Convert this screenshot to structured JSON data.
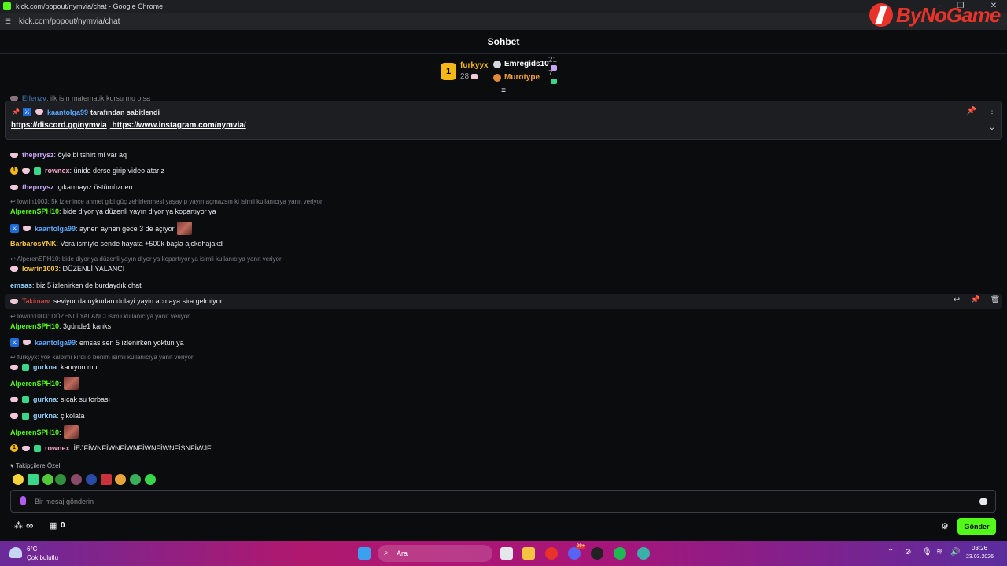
{
  "browser": {
    "title": "kick.com/popout/nymvia/chat - Google Chrome",
    "url": "kick.com/popout/nymvia/chat"
  },
  "watermark": "ByNoGame",
  "chat_header": {
    "title": "Sohbet"
  },
  "leaderboard": {
    "first": {
      "rank": "1",
      "name": "furkyyx",
      "count": "28"
    },
    "second": {
      "name": "Emregids10",
      "count": "21"
    },
    "third": {
      "name": "Murotype",
      "count": "7"
    }
  },
  "pinned": {
    "by_user": "kaantolga99",
    "by_text": "tarafından sabitlendi",
    "link1": "https://discord.gg/nymvia",
    "link2": "https://www.instagram.com/nymvia/"
  },
  "partial_top": {
    "user": "Ellenzv",
    "text": ": ilk işin matematik korsu mu olsa"
  },
  "messages": [
    {
      "user": "theprrysz",
      "text": ": öyle bi tshirt mi var aq",
      "color": "#c7a6f5"
    },
    {
      "user": "rownex",
      "text": ": ünide derse girip video atarız",
      "color": "#f5a3c7"
    },
    {
      "user": "theprrysz",
      "text": ": çıkarmayız üstümüzden",
      "color": "#c7a6f5"
    },
    {
      "reply": "lowrin1003: 5k izlenince ahmet gibi güç zehirlenmesi yaşayıp yayın açmazsın ki isimli kullanıcıya yanıt veriyor"
    },
    {
      "user": "AlperenSPH10",
      "text": ": bide diyor ya düzenli yayın diyor ya kopartıyor ya",
      "color": "#53fc18"
    },
    {
      "user": "kaantolga99",
      "text": ": aynen aynen gece 3 de açıyor",
      "color": "#5aa8ff"
    },
    {
      "user": "BarbarosYNK",
      "text": ": Vera ismiyle sende hayata +500k başla ajckdhajakd",
      "color": "#f5c542"
    },
    {
      "reply": "AlperenSPH10: bide diyor ya düzenli yayın diyor ya kopartıyor ya isimli kullanıcıya yanıt veriyor"
    },
    {
      "user": "lowrin1003",
      "text": ": DÜZENLİ YALANCI",
      "color": "#f5c542"
    },
    {
      "user": "emsas",
      "text": ": biz 5 izlenirken de burdaydık chat",
      "color": "#8fd3ff"
    },
    {
      "user": "Takimaw",
      "text": ": seviyor da uykudan dolayi yayin acmaya sira gelmiyor",
      "color": "#ff4d4d"
    },
    {
      "reply": "lowrin1003: DÜZENLİ YALANCI isimli kullanıcıya yanıt veriyor"
    },
    {
      "user": "AlperenSPH10",
      "text": ": 3günde1 kanks",
      "color": "#53fc18"
    },
    {
      "user": "kaantolga99",
      "text": ": emsas sen 5 izlenirken yoktun ya",
      "color": "#5aa8ff"
    },
    {
      "reply": "furkyyx: yok kalbimi kırdı o benim isimli kullanıcıya yanıt veriyor"
    },
    {
      "user": "gurkna",
      "text": ": kanıyon mu",
      "color": "#8fd3ff"
    },
    {
      "user": "AlperenSPH10",
      "text": ":",
      "color": "#53fc18"
    },
    {
      "user": "gurkna",
      "text": ": sıcak su torbası",
      "color": "#8fd3ff"
    },
    {
      "user": "gurkna",
      "text": ": çikolata",
      "color": "#8fd3ff"
    },
    {
      "user": "AlperenSPH10",
      "text": ":",
      "color": "#53fc18"
    },
    {
      "user": "rownex",
      "text": ": İEJFİWNFİWNFİWNFİWNFİWNFİSNFİWJF",
      "color": "#f5a3c7"
    }
  ],
  "emote_bar": {
    "label": "Takipçilere Özel"
  },
  "input": {
    "placeholder": "Bir mesaj gönderin"
  },
  "bottom": {
    "infinity": "∞",
    "points": "0",
    "send": "Gönder"
  },
  "taskbar": {
    "temp": "6°C",
    "weather": "Çok bulutlu",
    "search": "Ara",
    "time": "03:26",
    "date": "23.03.2026",
    "notif": "99+"
  }
}
